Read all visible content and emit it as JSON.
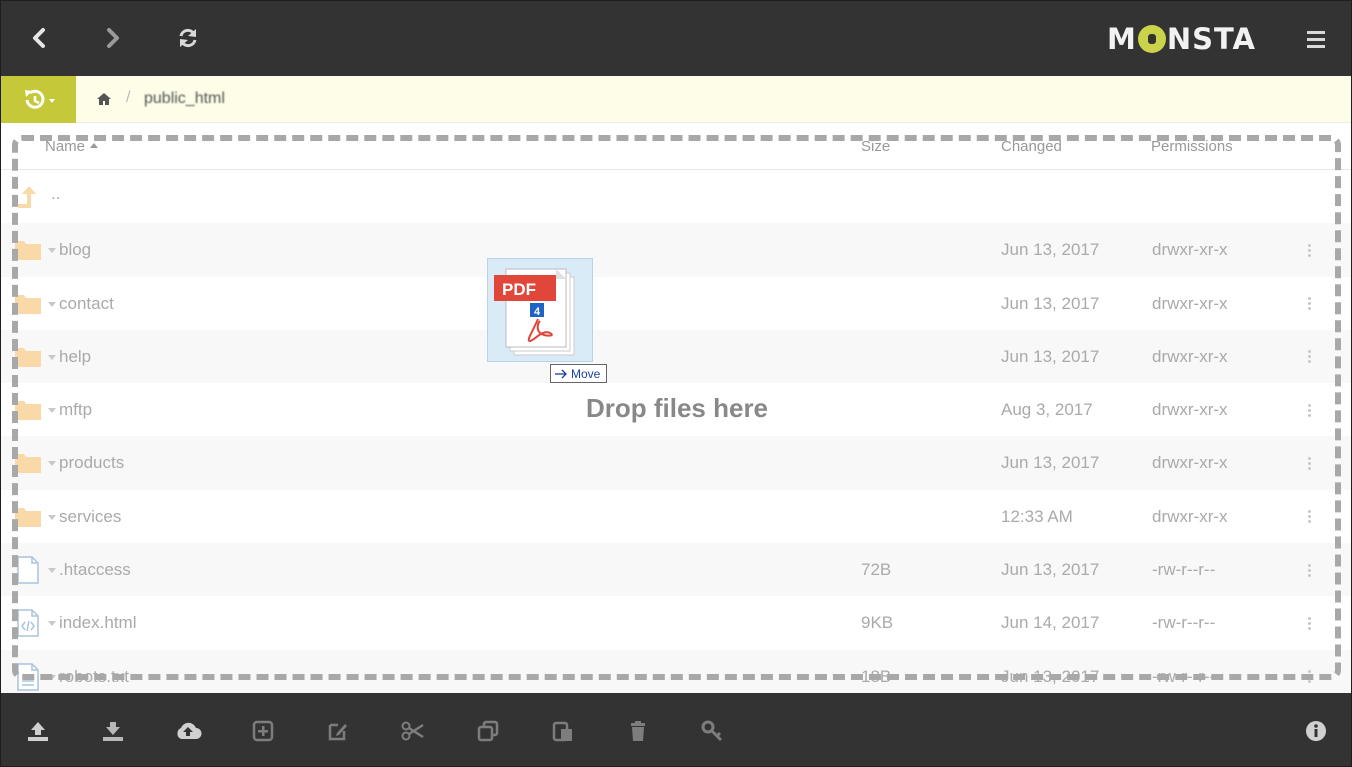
{
  "topbar": {
    "logo_text": "MONSTA",
    "back_icon": "chevron-left-icon",
    "forward_icon": "chevron-right-icon",
    "refresh_icon": "refresh-icon",
    "menu_icon": "hamburger-menu-icon"
  },
  "breadcrumb": {
    "history_icon": "history-icon",
    "home_icon": "home-icon",
    "separator": "/",
    "current": "public_html"
  },
  "table": {
    "columns": {
      "name": "Name",
      "size": "Size",
      "changed": "Changed",
      "permissions": "Permissions"
    },
    "parent_label": "..",
    "rows": [
      {
        "type": "folder",
        "name": "blog",
        "size": "",
        "changed": "Jun 13, 2017",
        "permissions": "drwxr-xr-x"
      },
      {
        "type": "folder",
        "name": "contact",
        "size": "",
        "changed": "Jun 13, 2017",
        "permissions": "drwxr-xr-x"
      },
      {
        "type": "folder",
        "name": "help",
        "size": "",
        "changed": "Jun 13, 2017",
        "permissions": "drwxr-xr-x"
      },
      {
        "type": "folder",
        "name": "mftp",
        "size": "",
        "changed": "Aug 3, 2017",
        "permissions": "drwxr-xr-x"
      },
      {
        "type": "folder",
        "name": "products",
        "size": "",
        "changed": "Jun 13, 2017",
        "permissions": "drwxr-xr-x"
      },
      {
        "type": "folder",
        "name": "services",
        "size": "",
        "changed": "12:33 AM",
        "permissions": "drwxr-xr-x"
      },
      {
        "type": "file",
        "name": ".htaccess",
        "size": "72B",
        "changed": "Jun 13, 2017",
        "permissions": "-rw-r--r--"
      },
      {
        "type": "code",
        "name": "index.html",
        "size": "9KB",
        "changed": "Jun 14, 2017",
        "permissions": "-rw-r--r--"
      },
      {
        "type": "text",
        "name": "robots.txt",
        "size": "18B",
        "changed": "Jun 13, 2017",
        "permissions": "-rw-r--r--"
      }
    ]
  },
  "drop": {
    "message": "Drop files here",
    "drag_badge_label": "PDF",
    "drag_count": "4",
    "move_tooltip": "Move"
  },
  "toolbar": {
    "items": [
      "upload-icon",
      "download-icon",
      "cloud-upload-icon",
      "new-item-icon",
      "edit-icon",
      "cut-icon",
      "copy-icon",
      "paste-icon",
      "delete-icon",
      "key-icon",
      "info-icon"
    ]
  },
  "colors": {
    "chrome": "#333333",
    "accent": "#c5c838",
    "breadcrumb_bg": "#fdfde8",
    "folder": "#f9d9a8"
  }
}
